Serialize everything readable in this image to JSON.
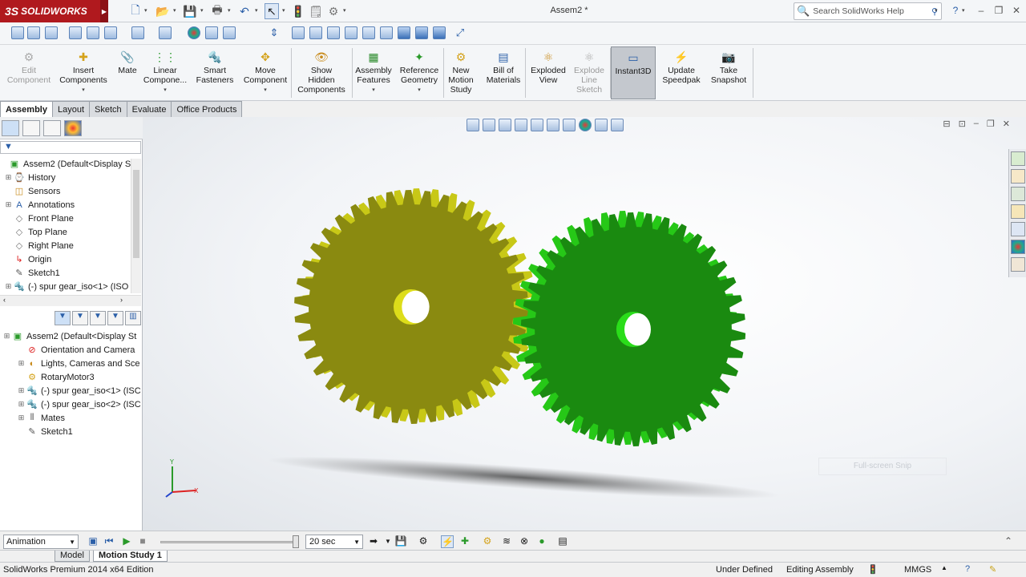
{
  "app": {
    "brand": "SOLIDWORKS",
    "brand_prefix": "3S",
    "document_title": "Assem2 *"
  },
  "search": {
    "placeholder": "Search SolidWorks Help"
  },
  "ribbon": {
    "items": [
      {
        "label": "Edit Component",
        "lines": [
          "Edit",
          "Component"
        ],
        "enabled": false
      },
      {
        "label": "Insert Components",
        "lines": [
          "Insert",
          "Components"
        ],
        "enabled": true
      },
      {
        "label": "Mate",
        "lines": [
          "Mate"
        ],
        "enabled": true
      },
      {
        "label": "Linear Compone...",
        "lines": [
          "Linear",
          "Compone..."
        ],
        "enabled": true
      },
      {
        "label": "Smart Fasteners",
        "lines": [
          "Smart",
          "Fasteners"
        ],
        "enabled": true
      },
      {
        "label": "Move Component",
        "lines": [
          "Move",
          "Component"
        ],
        "enabled": true
      },
      {
        "label": "Show Hidden Components",
        "lines": [
          "Show",
          "Hidden",
          "Components"
        ],
        "enabled": true
      },
      {
        "label": "Assembly Features",
        "lines": [
          "Assembly",
          "Features"
        ],
        "enabled": true
      },
      {
        "label": "Reference Geometry",
        "lines": [
          "Reference",
          "Geometry"
        ],
        "enabled": true
      },
      {
        "label": "New Motion Study",
        "lines": [
          "New",
          "Motion",
          "Study"
        ],
        "enabled": true
      },
      {
        "label": "Bill of Materials",
        "lines": [
          "Bill of",
          "Materials"
        ],
        "enabled": true
      },
      {
        "label": "Exploded View",
        "lines": [
          "Exploded",
          "View"
        ],
        "enabled": true
      },
      {
        "label": "Explode Line Sketch",
        "lines": [
          "Explode",
          "Line",
          "Sketch"
        ],
        "enabled": false
      },
      {
        "label": "Instant3D",
        "lines": [
          "Instant3D"
        ],
        "enabled": true,
        "active": true
      },
      {
        "label": "Update Speedpak",
        "lines": [
          "Update",
          "Speedpak"
        ],
        "enabled": true
      },
      {
        "label": "Take Snapshot",
        "lines": [
          "Take",
          "Snapshot"
        ],
        "enabled": true
      }
    ]
  },
  "tabs": [
    "Assembly",
    "Layout",
    "Sketch",
    "Evaluate",
    "Office Products"
  ],
  "feature_tree": {
    "root": "Assem2  (Default<Display St",
    "items": [
      "History",
      "Sensors",
      "Annotations",
      "Front Plane",
      "Top Plane",
      "Right Plane",
      "Origin",
      "Sketch1",
      "(-) spur gear_iso<1> (ISO"
    ]
  },
  "motion_tree": {
    "root": "Assem2  (Default<Display St",
    "items": [
      "Orientation and Camera",
      "Lights, Cameras and Sce",
      "RotaryMotor3",
      "(-) spur gear_iso<1> (ISC",
      "(-) spur gear_iso<2> (ISC",
      "Mates",
      "Sketch1"
    ]
  },
  "viewport": {
    "snip_label": "Full-screen Snip",
    "gear1_color": "#8a8a10",
    "gear2_color": "#1a8a10"
  },
  "motion": {
    "study_type": "Animation",
    "duration": "20 sec"
  },
  "study_tabs": [
    "Model",
    "Motion Study 1"
  ],
  "status": {
    "edition": "SolidWorks Premium 2014 x64 Edition",
    "definition": "Under Defined",
    "mode": "Editing Assembly",
    "units": "MMGS"
  }
}
